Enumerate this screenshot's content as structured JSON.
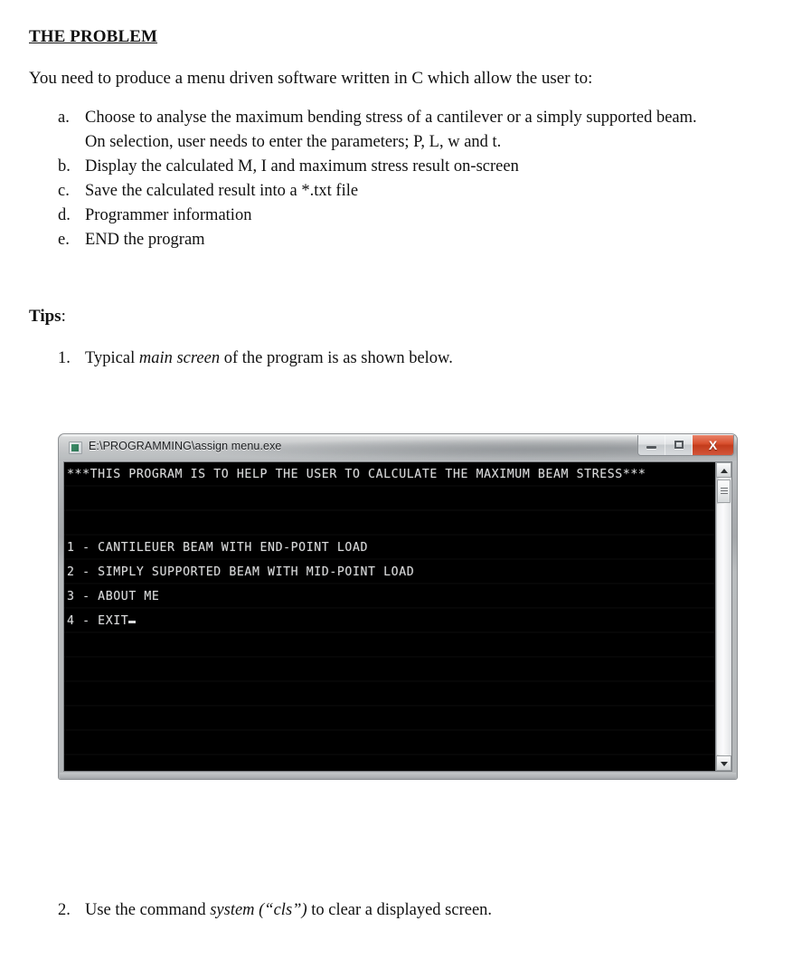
{
  "document": {
    "heading": "THE PROBLEM",
    "intro": "You need to produce a menu driven software written in C which allow the user to:",
    "problem_items": [
      {
        "marker": "a.",
        "text": "Choose to analyse the maximum bending stress of a cantilever or a simply supported beam.",
        "continuation": "On selection, user needs to enter the parameters; P, L, w and t."
      },
      {
        "marker": "b.",
        "text": "Display the calculated M, I and maximum stress result on-screen",
        "continuation": ""
      },
      {
        "marker": "c.",
        "text": "Save the calculated result into a *.txt file",
        "continuation": ""
      },
      {
        "marker": "d.",
        "text": "Programmer information",
        "continuation": ""
      },
      {
        "marker": "e.",
        "text": "END the program",
        "continuation": ""
      }
    ],
    "tips_label": "Tips",
    "tips_colon": ":",
    "tip_one": {
      "marker": "1.",
      "before": "Typical ",
      "italic": "main screen",
      "after": " of the program is as shown below."
    },
    "tip_two": {
      "marker": "2.",
      "before": "Use the command ",
      "italic": "system (“cls”)",
      "after": " to clear a displayed screen."
    }
  },
  "console_window": {
    "title": "E:\\PROGRAMMING\\assign menu.exe",
    "icon": "console-app-icon",
    "buttons": {
      "minimize": "minimize-icon",
      "maximize": "maximize-icon",
      "close_label": "X"
    },
    "screen_background": "#000000",
    "screen_text_color": "#d9dadb",
    "close_button_color": "#cf4421",
    "lines": [
      "***THIS PROGRAM IS TO HELP THE USER TO CALCULATE THE MAXIMUM BEAM STRESS***",
      "",
      "",
      "1 - CANTILEUER BEAM WITH END-POINT LOAD",
      "2 - SIMPLY SUPPORTED BEAM WITH MID-POINT LOAD",
      "3 - ABOUT ME",
      "4 - EXIT"
    ],
    "scrollbar": {
      "up_arrow": "scroll-up-icon",
      "down_arrow": "scroll-down-icon"
    }
  }
}
